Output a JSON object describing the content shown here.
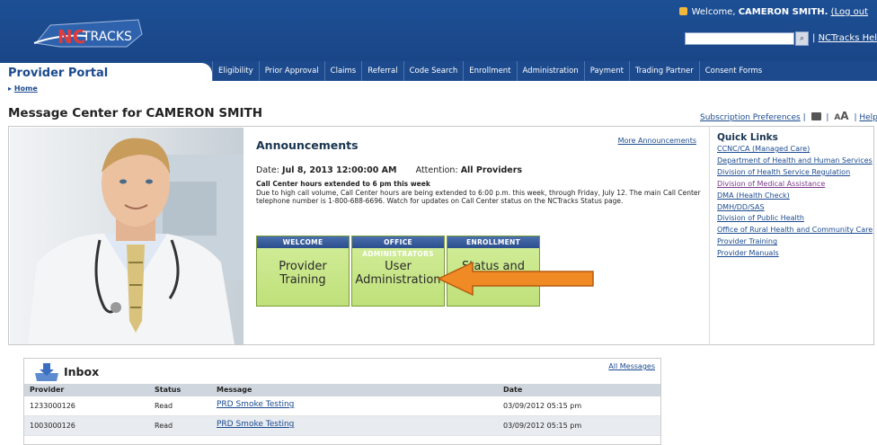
{
  "header": {
    "logo_text": "NCTRACKS",
    "welcome_prefix": "Welcome,",
    "user_name": "CAMERON SMITH.",
    "logout": "(Log out",
    "search_placeholder": "",
    "help_link": "NCTracks Help"
  },
  "nav": {
    "portal_title": "Provider Portal",
    "items": [
      "Eligibility",
      "Prior Approval",
      "Claims",
      "Referral",
      "Code Search",
      "Enrollment",
      "Administration",
      "Payment",
      "Trading Partner",
      "Consent Forms"
    ]
  },
  "breadcrumb": {
    "arrow": "▸",
    "home": "Home"
  },
  "page_title": "Message Center for CAMERON SMITH",
  "toolbar": {
    "subscription": "Subscription Preferences",
    "sep": "|",
    "aa_small": "A",
    "aa_big": "A",
    "help": "Help"
  },
  "announcements": {
    "title": "Announcements",
    "more": "More Announcements",
    "date_label": "Date:",
    "date_value": "Jul 8, 2013 12:00:00 AM",
    "attention_label": "Attention:",
    "attention_value": "All Providers",
    "subject": "Call Center hours extended to 6 pm this week",
    "body": "Due to high call volume, Call Center hours are being extended to 6:00 p.m. this week, through Friday, July 12. The main Call Center telephone number is 1-800-688-6696. Watch for updates on Call Center status on the NCTracks Status page."
  },
  "tiles": [
    {
      "caption": "WELCOME",
      "label": "Provider Training"
    },
    {
      "caption": "OFFICE ADMINISTRATORS",
      "label": "User Administration"
    },
    {
      "caption": "ENROLLMENT",
      "label": "Status and Management"
    }
  ],
  "quick_links": {
    "title": "Quick Links",
    "links": [
      "CCNC/CA (Managed Care)",
      "Department of Health and Human Services",
      "Division of Health Service Regulation",
      "Division of Medical Assistance",
      "DMA (Health Check)",
      "DMH/DD/SAS",
      "Division of Public Health",
      "Office of Rural Health and Community Care",
      "Provider Training",
      "Provider Manuals"
    ]
  },
  "inbox": {
    "title": "Inbox",
    "all_messages": "All Messages",
    "columns": [
      "Provider",
      "Status",
      "Message",
      "Date"
    ],
    "rows": [
      {
        "provider": "1233000126",
        "status": "Read",
        "message": "PRD Smoke Testing",
        "date": "03/09/2012 05:15 pm"
      },
      {
        "provider": "1003000126",
        "status": "Read",
        "message": "PRD Smoke Testing",
        "date": "03/09/2012 05:15 pm"
      }
    ]
  },
  "colors": {
    "brand_blue": "#1c4a8d",
    "tile_green": "#c6e486",
    "arrow_orange": "#f08a24"
  }
}
